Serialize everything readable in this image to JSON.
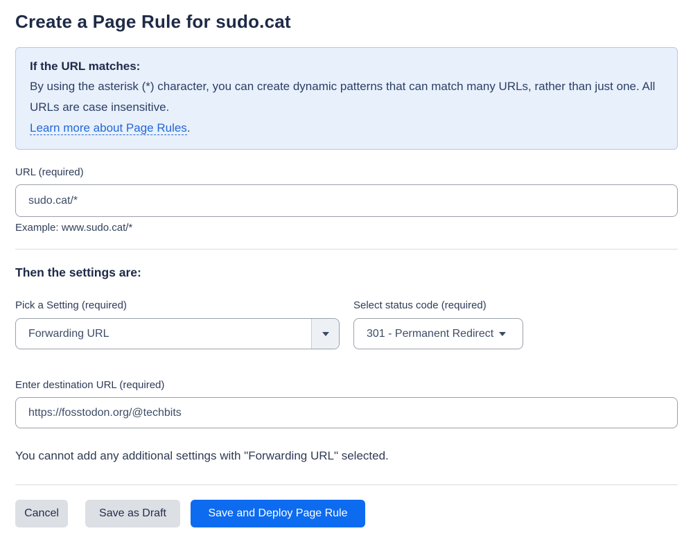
{
  "page": {
    "title": "Create a Page Rule for sudo.cat"
  },
  "info_box": {
    "heading": "If the URL matches:",
    "body": "By using the asterisk (*) character, you can create dynamic patterns that can match many URLs, rather than just one. All URLs are case insensitive.",
    "link_label": "Learn more about Page Rules",
    "link_suffix": "."
  },
  "url_field": {
    "label": "URL (required)",
    "value": "sudo.cat/*",
    "helper": "Example: www.sudo.cat/*"
  },
  "settings": {
    "heading": "Then the settings are:",
    "setting_select": {
      "label": "Pick a Setting (required)",
      "value": "Forwarding URL"
    },
    "status_select": {
      "label": "Select status code (required)",
      "value": "301 - Permanent Redirect"
    },
    "destination_field": {
      "label": "Enter destination URL (required)",
      "value": "https://fosstodon.org/@techbits"
    },
    "note": "You cannot add any additional settings with \"Forwarding URL\" selected."
  },
  "footer": {
    "cancel_label": "Cancel",
    "save_draft_label": "Save as Draft",
    "save_deploy_label": "Save and Deploy Page Rule"
  },
  "colors": {
    "accent_blue": "#0d6bf0",
    "info_bg": "#e8f0fc",
    "info_border": "#b3c9e8",
    "link_blue": "#2268d5",
    "button_gray": "#dcdfe4",
    "divider_gray": "#d8dce2"
  }
}
